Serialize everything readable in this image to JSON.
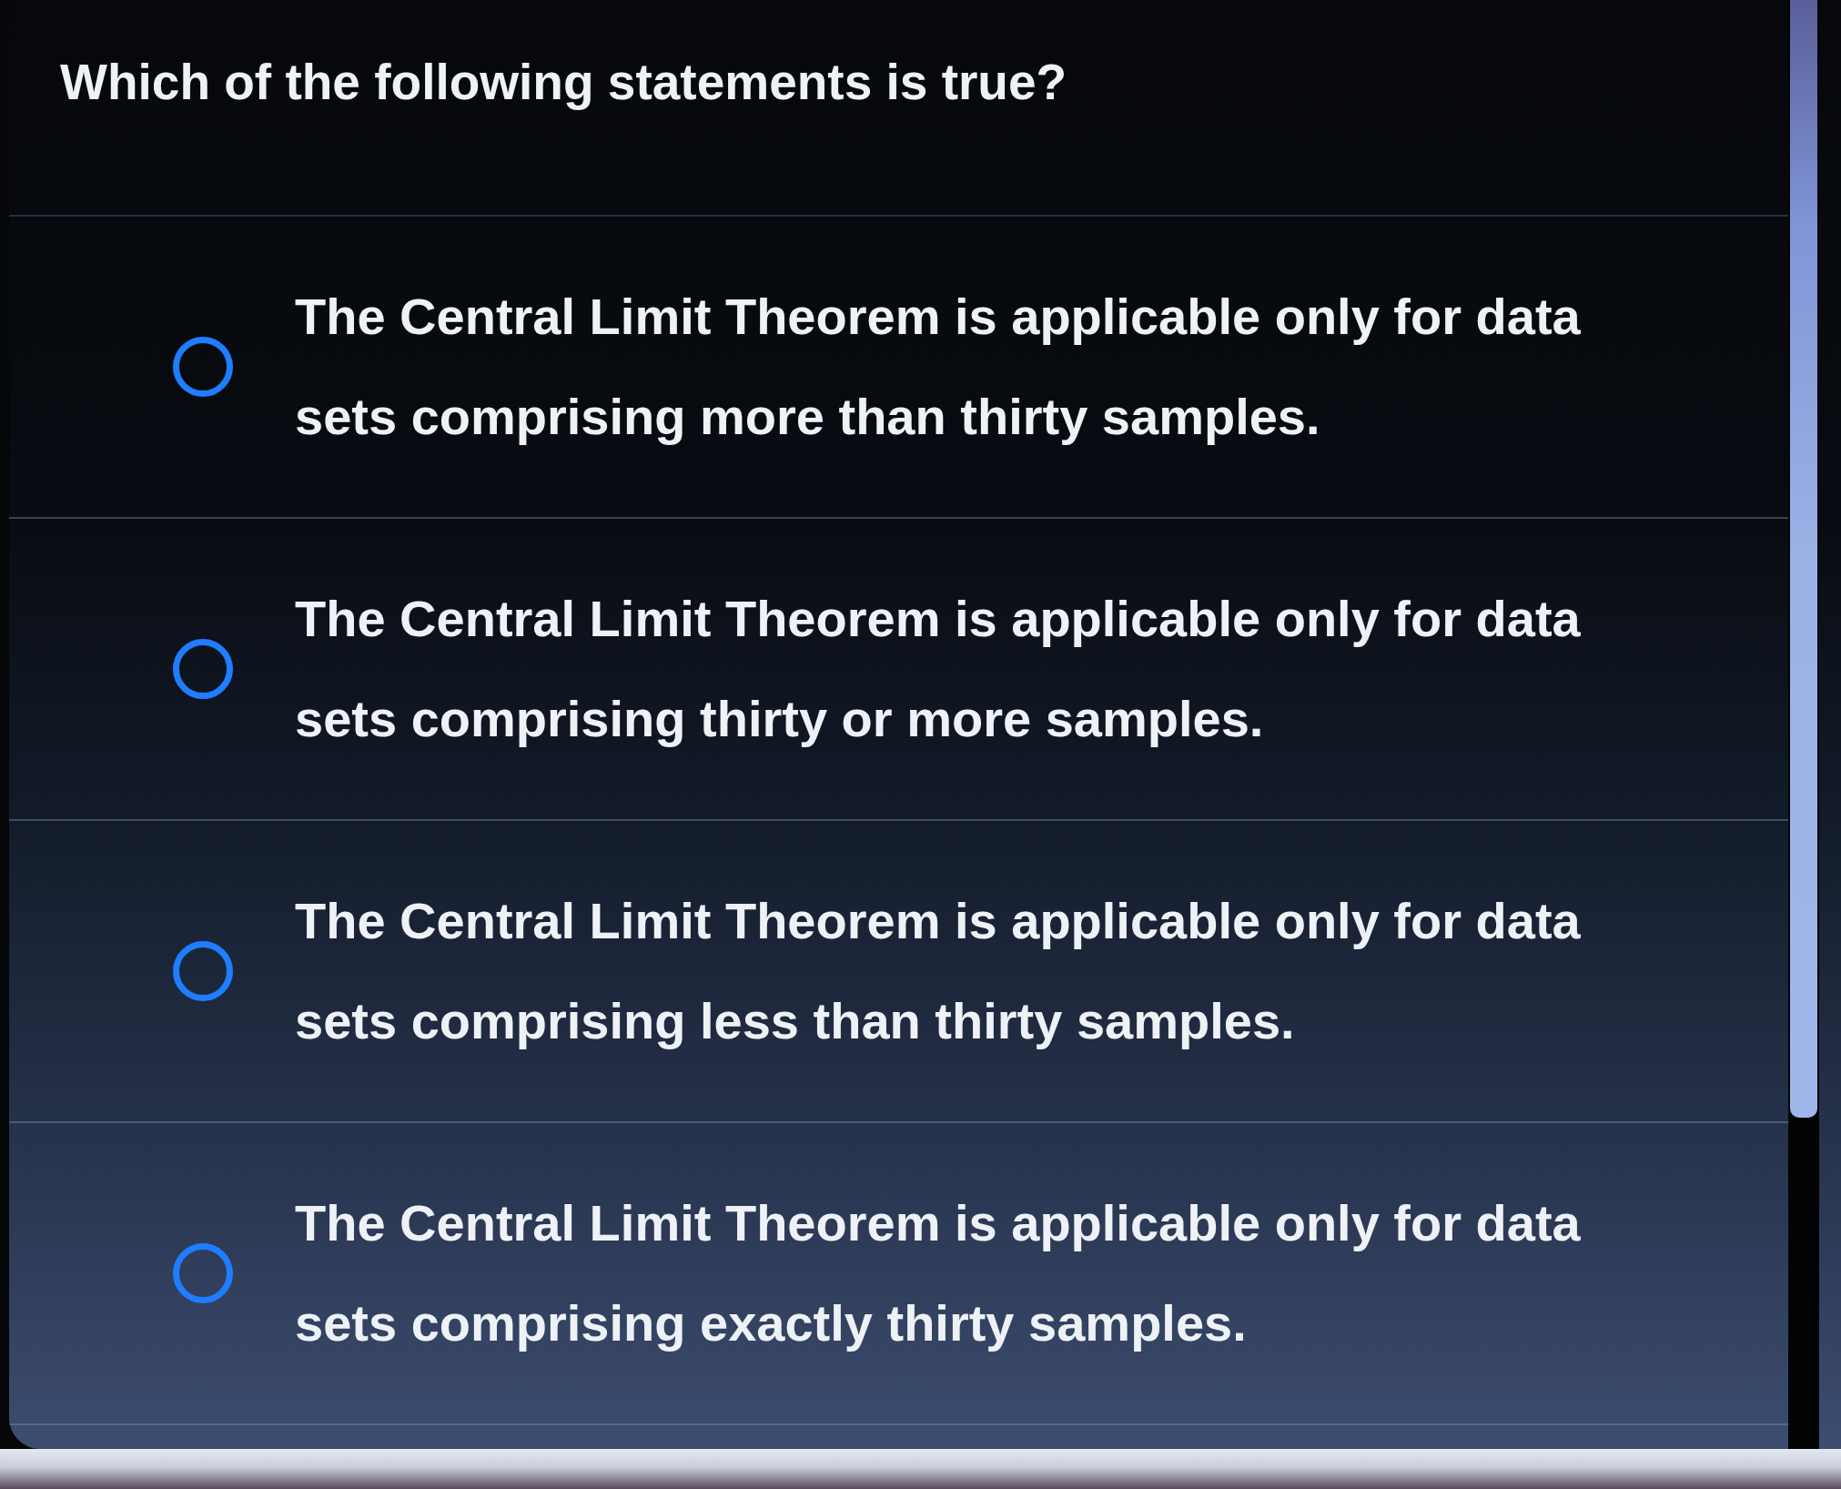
{
  "question": {
    "text": "Which of the following statements is true?"
  },
  "options": [
    {
      "label": "The Central Limit Theorem is applicable only for data sets comprising more than thirty samples.",
      "selected": false
    },
    {
      "label": "The Central Limit Theorem is applicable only for data sets comprising thirty or more samples.",
      "selected": false
    },
    {
      "label": "The Central Limit Theorem is applicable only for data sets comprising less than thirty samples.",
      "selected": false
    },
    {
      "label": "The Central Limit Theorem is applicable only for data sets comprising exactly thirty samples.",
      "selected": false
    }
  ]
}
